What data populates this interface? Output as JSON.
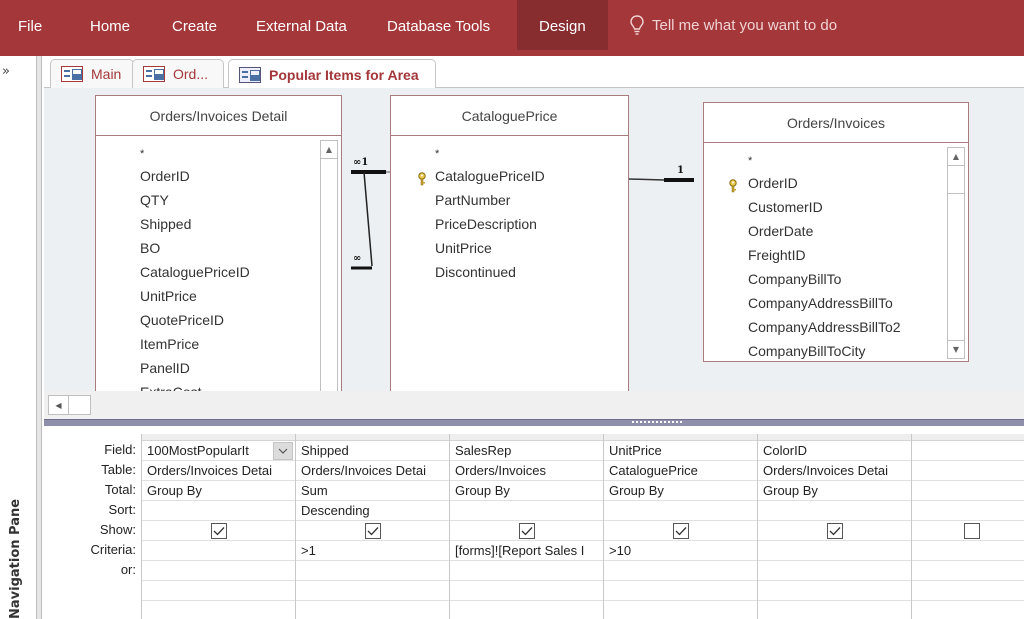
{
  "ribbon": {
    "tabs": [
      {
        "label": "File"
      },
      {
        "label": "Home"
      },
      {
        "label": "Create"
      },
      {
        "label": "External Data"
      },
      {
        "label": "Database Tools"
      },
      {
        "label": "Design",
        "active": true
      }
    ],
    "tell_me": "Tell me what you want to do"
  },
  "nav_pane": {
    "toggle": "»",
    "label": "Navigation Pane"
  },
  "doc_tabs": [
    {
      "label": "Main",
      "icon": "form-icon"
    },
    {
      "label": "Ord...",
      "icon": "form-icon"
    },
    {
      "label": "Popular Items for Area",
      "icon": "query-icon",
      "active": true
    }
  ],
  "tables": {
    "orders_invoices_detail": {
      "title": "Orders/Invoices Detail",
      "fields": [
        "*",
        "OrderID",
        "QTY",
        "Shipped",
        "BO",
        "CataloguePriceID",
        "UnitPrice",
        "QuotePriceID",
        "ItemPrice",
        "PanelID",
        "ExtraCost"
      ]
    },
    "catalogue_price": {
      "title": "CataloguePrice",
      "key_field": "CataloguePriceID",
      "fields": [
        "*",
        "CataloguePriceID",
        "PartNumber",
        "PriceDescription",
        "UnitPrice",
        "Discontinued"
      ]
    },
    "orders_invoices": {
      "title": "Orders/Invoices",
      "key_field": "OrderID",
      "fields": [
        "*",
        "OrderID",
        "CustomerID",
        "OrderDate",
        "FreightID",
        "CompanyBillTo",
        "CompanyAddressBillTo",
        "CompanyAddressBillTo2",
        "CompanyBillToCity"
      ]
    }
  },
  "relationships": {
    "left_one": "∞1",
    "left_many": "∞",
    "right_one": "1"
  },
  "grid": {
    "row_labels": [
      "Field:",
      "Table:",
      "Total:",
      "Sort:",
      "Show:",
      "Criteria:",
      "or:"
    ],
    "columns": [
      {
        "field": "100MostPopularIt",
        "table": "Orders/Invoices Detai",
        "total": "Group By",
        "sort": "",
        "show": true,
        "criteria": "",
        "or": "",
        "has_dropdown": true
      },
      {
        "field": "Shipped",
        "table": "Orders/Invoices Detai",
        "total": "Sum",
        "sort": "Descending",
        "show": true,
        "criteria": ">1",
        "or": ""
      },
      {
        "field": "SalesRep",
        "table": "Orders/Invoices",
        "total": "Group By",
        "sort": "",
        "show": true,
        "criteria": "[forms]![Report Sales I",
        "or": ""
      },
      {
        "field": "UnitPrice",
        "table": "CataloguePrice",
        "total": "Group By",
        "sort": "",
        "show": true,
        "criteria": ">10",
        "or": ""
      },
      {
        "field": "ColorID",
        "table": "Orders/Invoices Detai",
        "total": "Group By",
        "sort": "",
        "show": true,
        "criteria": "",
        "or": ""
      },
      {
        "field": "",
        "table": "",
        "total": "",
        "sort": "",
        "show": false,
        "criteria": "",
        "or": ""
      }
    ]
  }
}
